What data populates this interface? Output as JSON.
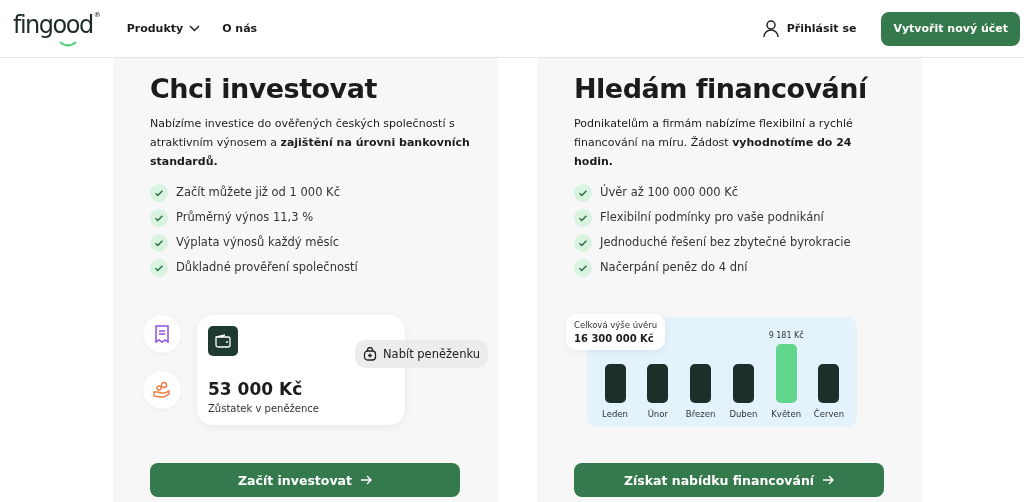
{
  "header": {
    "logo": {
      "name": "fingood",
      "mark": "®"
    },
    "nav": [
      {
        "label": "Produkty",
        "dropdown": true
      },
      {
        "label": "O nás",
        "dropdown": false
      }
    ],
    "login": "Přihlásit se",
    "cta": "Vytvořit nový účet"
  },
  "cards": [
    {
      "kind": "wallet",
      "title": "Chci investovat",
      "text": "Nabízíme investice do ověřených českých společností s atraktivním výnosem a **zajištění na úrovni bankovních standardů.**",
      "features": [
        "Začít můžete již od 1 000 Kč",
        "Průměrný výnos 11,3 %",
        "Výplata výnosů každý měsíc",
        "Důkladné prověření společností"
      ],
      "wallet": {
        "amount": "53 000 Kč",
        "caption": "Zůstatek v peněžence",
        "action": "Nabít peněženku"
      },
      "button": "Začít investovat"
    },
    {
      "kind": "chart",
      "title": "Hledám financování",
      "text": "Podnikatelům a firmám nabízíme flexibilní a rychlé financování na míru. Žádost **vyhodnotíme do 24 hodin.**",
      "features": [
        "Úvěr až 100 000 000 Kč",
        "Flexibilní podmínky pro vaše podnikání",
        "Jednoduché řešení bez zbytečné byrokracie",
        "Načerpání peněz do 4 dní"
      ],
      "loan": {
        "label": "Celková výše úvěru",
        "amount": "16 300 000 Kč",
        "months": [
          {
            "label": "Leden",
            "selected": false
          },
          {
            "label": "Únor",
            "selected": false
          },
          {
            "label": "Březen",
            "selected": false
          },
          {
            "label": "Duben",
            "selected": false
          },
          {
            "label": "Květen",
            "selected": true,
            "value": "9 181 Kč"
          },
          {
            "label": "Červen",
            "selected": false
          }
        ]
      },
      "button": "Získat nabídku financování"
    }
  ]
}
